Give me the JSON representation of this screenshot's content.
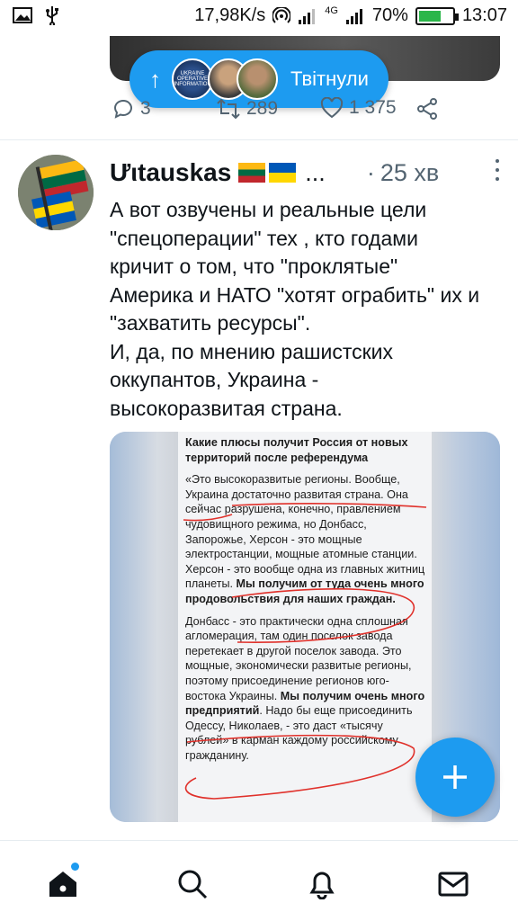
{
  "status_bar": {
    "speed": "17,98K/s",
    "network": "4G",
    "battery_percent": "70%",
    "battery_level": 0.7,
    "time": "13:07"
  },
  "prev_tweet": {
    "pill_label": "Твітнули",
    "avatar_text": "UKRAINE OPERATIVE INFORMATION",
    "reply_count": "3",
    "retweet_count": "289",
    "like_count": "1 375"
  },
  "tweet": {
    "author": "Ưιtauskas",
    "ellipsis": "...",
    "dot": "·",
    "time": "25 хв",
    "text_lines": [
      "А вот озвучены и реальные цели",
      "\"спецоперации\" тех , кто годами",
      "кричит о том, что \"проклятые\"",
      "Америка и НАТО \"хотят ограбить\" их и",
      "\"захватить ресурсы\".",
      "И, да, по мнению рашистских",
      "оккупантов, Украина -",
      "высокоразвитая страна."
    ],
    "image_doc": {
      "heading": "Какие плюсы получит Россия от новых территорий после референдума",
      "p1_a": "«Это высокоразвитые регионы. Вообще, Украина достаточно развитая страна. Она сейчас разрушена, конечно, правлением чудовищного режима, но Донбасс, Запорожье, Херсон - это мощные электростанции, мощные атомные станции. Херсон - это вообще одна из главных житниц планеты. ",
      "p1_b": "Мы получим от туда очень много продовольствия для наших граждан.",
      "p2_a": "Донбасс - это практически одна сплошная агломерация, там один поселок завода перетекает в другой поселок завода. Это мощные, экономически развитые регионы, поэтому присоединение регионов юго-востока Украины. ",
      "p2_b": "Мы получим очень много предприятий",
      "p2_c": ". Надо бы еще присоединить Одессу, Николаев, - это даст «тысячу рублей» в карман каждому российскому гражданину."
    }
  },
  "colors": {
    "accent": "#1d9bf0",
    "text": "#0f1419",
    "muted": "#536471",
    "annotation_red": "#e0312b"
  },
  "icons": {
    "fab": "plus-icon",
    "nav": [
      "home-icon",
      "search-icon",
      "bell-icon",
      "mail-icon"
    ]
  }
}
